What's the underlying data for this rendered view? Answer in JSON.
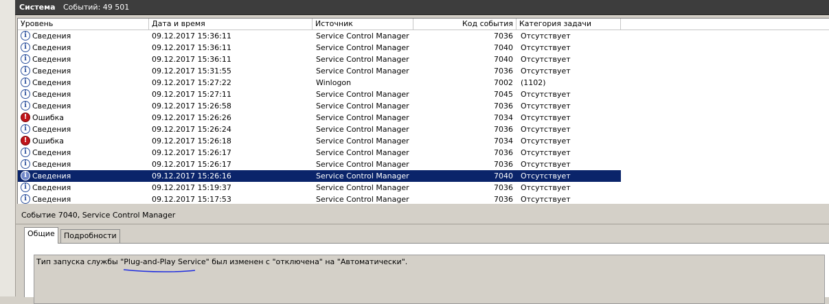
{
  "title": {
    "log_name": "Система",
    "event_count": "Событий: 49 501"
  },
  "columns": {
    "level": "Уровень",
    "datetime": "Дата и время",
    "source": "Источник",
    "event_id": "Код события",
    "task_category": "Категория задачи"
  },
  "rows": [
    {
      "level": "Сведения",
      "type": "info",
      "datetime": "09.12.2017 15:36:11",
      "source": "Service Control Manager",
      "event_id": "7036",
      "category": "Отсутствует"
    },
    {
      "level": "Сведения",
      "type": "info",
      "datetime": "09.12.2017 15:36:11",
      "source": "Service Control Manager",
      "event_id": "7040",
      "category": "Отсутствует"
    },
    {
      "level": "Сведения",
      "type": "info",
      "datetime": "09.12.2017 15:36:11",
      "source": "Service Control Manager",
      "event_id": "7040",
      "category": "Отсутствует"
    },
    {
      "level": "Сведения",
      "type": "info",
      "datetime": "09.12.2017 15:31:55",
      "source": "Service Control Manager",
      "event_id": "7036",
      "category": "Отсутствует"
    },
    {
      "level": "Сведения",
      "type": "info",
      "datetime": "09.12.2017 15:27:22",
      "source": "Winlogon",
      "event_id": "7002",
      "category": "(1102)"
    },
    {
      "level": "Сведения",
      "type": "info",
      "datetime": "09.12.2017 15:27:11",
      "source": "Service Control Manager",
      "event_id": "7045",
      "category": "Отсутствует"
    },
    {
      "level": "Сведения",
      "type": "info",
      "datetime": "09.12.2017 15:26:58",
      "source": "Service Control Manager",
      "event_id": "7036",
      "category": "Отсутствует"
    },
    {
      "level": "Ошибка",
      "type": "error",
      "datetime": "09.12.2017 15:26:26",
      "source": "Service Control Manager",
      "event_id": "7034",
      "category": "Отсутствует"
    },
    {
      "level": "Сведения",
      "type": "info",
      "datetime": "09.12.2017 15:26:24",
      "source": "Service Control Manager",
      "event_id": "7036",
      "category": "Отсутствует"
    },
    {
      "level": "Ошибка",
      "type": "error",
      "datetime": "09.12.2017 15:26:18",
      "source": "Service Control Manager",
      "event_id": "7034",
      "category": "Отсутствует"
    },
    {
      "level": "Сведения",
      "type": "info",
      "datetime": "09.12.2017 15:26:17",
      "source": "Service Control Manager",
      "event_id": "7036",
      "category": "Отсутствует"
    },
    {
      "level": "Сведения",
      "type": "info",
      "datetime": "09.12.2017 15:26:17",
      "source": "Service Control Manager",
      "event_id": "7036",
      "category": "Отсутствует"
    },
    {
      "level": "Сведения",
      "type": "info",
      "datetime": "09.12.2017 15:26:16",
      "source": "Service Control Manager",
      "event_id": "7040",
      "category": "Отсутствует",
      "selected": true
    },
    {
      "level": "Сведения",
      "type": "info",
      "datetime": "09.12.2017 15:19:37",
      "source": "Service Control Manager",
      "event_id": "7036",
      "category": "Отсутствует"
    },
    {
      "level": "Сведения",
      "type": "info",
      "datetime": "09.12.2017 15:17:53",
      "source": "Service Control Manager",
      "event_id": "7036",
      "category": "Отсутствует"
    }
  ],
  "detail": {
    "title": "Событие 7040, Service Control Manager",
    "tabs": [
      "Общие",
      "Подробности"
    ],
    "active_tab": "Общие",
    "message": "Тип запуска службы \"Plug-and-Play Service\" был изменен с \"отключена\" на \"Автоматически\"."
  },
  "colors": {
    "selection": "#0a246a",
    "annotation": "#1d2be0",
    "titlebar": "#3d3d3d"
  }
}
